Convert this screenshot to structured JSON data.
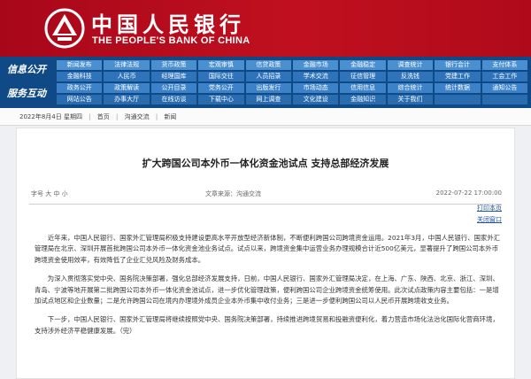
{
  "header": {
    "bank_name_cn": "中国人民银行",
    "bank_name_en": "THE PEOPLE'S BANK OF CHINA",
    "brand_color": "#b30c1c",
    "logo_icon": "pboc-emblem-icon"
  },
  "nav": {
    "section_info": "信息公开",
    "section_service": "服务互动",
    "rows": [
      [
        "新闻发布",
        "法律法规",
        "货币政策",
        "宏观审慎",
        "信贷政策",
        "金融市场",
        "金融稳定",
        "调查统计",
        "银行会计",
        "支付体系"
      ],
      [
        "金融科技",
        "人民币",
        "经理国库",
        "国际交往",
        "人员招录",
        "学术交流",
        "征信管理",
        "反洗钱",
        "党建工作",
        "工会工作"
      ],
      [
        "政务公开",
        "政策解读",
        "公开目录",
        "党务公开",
        "出版发行",
        "市场动态",
        "信用信息",
        "综合统计",
        "统计数据",
        "通知公告"
      ],
      [
        "网站公告",
        "办事大厅",
        "在线访谈",
        "下载中心",
        "网上调查",
        "文化建设",
        "金融知识",
        "关于我们",
        "",
        ""
      ]
    ]
  },
  "breadcrumb": {
    "items": [
      "2022年8月4日 星期四",
      "首页",
      "沟通交流",
      "新闻"
    ],
    "separator": "|"
  },
  "article": {
    "title": "扩大跨国公司本外币一体化资金池试点 支持总部经济发展",
    "meta_left": "字号 大 中 小",
    "meta_source": "文章来源：沟通交流",
    "meta_date": "2022-07-22 17:00:00",
    "tools": [
      "打印本页",
      "关闭窗口"
    ],
    "paragraphs": [
      "近年来，中国人民银行、国家外汇管理局积极支持建设更高水平开放型经济新体制，不断便利跨国公司跨境资金运用。2021年3月，中国人民银行、国家外汇管理局在北京、深圳开展首批跨国公司本外币一体化资金池业务试点。试点以来，跨境资金集中运营业务办理规模合计近500亿美元，显著提升了跨国公司本外币跨境资金使用效率，有效降低了企业汇兑风险及财务成本。",
      "为深入贯彻落实党中央、国务院决策部署，强化总部经济发展支持，日前，中国人民银行、国家外汇管理局决定，在上海、广东、陕西、北京、浙江、深圳、青岛、宁波等地开展第二批跨国公司本外币一体化资金池试点，进一步优化管理政策，便利跨国公司企业跨境资金统筹使用。此次试点政策内容主要包括：一是增加试点地区和企业数量；二是允许跨国公司在境内办理境外成员企业本外币集中收付业务；三是进一步便利跨国公司以人民币开展跨境收支业务。",
      "下一步，中国人民银行、国家外汇管理局将继续按照党中央、国务院决策部署，持续推进跨境贸易和投融资便利化，着力营造市场化法治化国际化营商环境，支持涉外经济平稳健康发展。（完）"
    ]
  }
}
